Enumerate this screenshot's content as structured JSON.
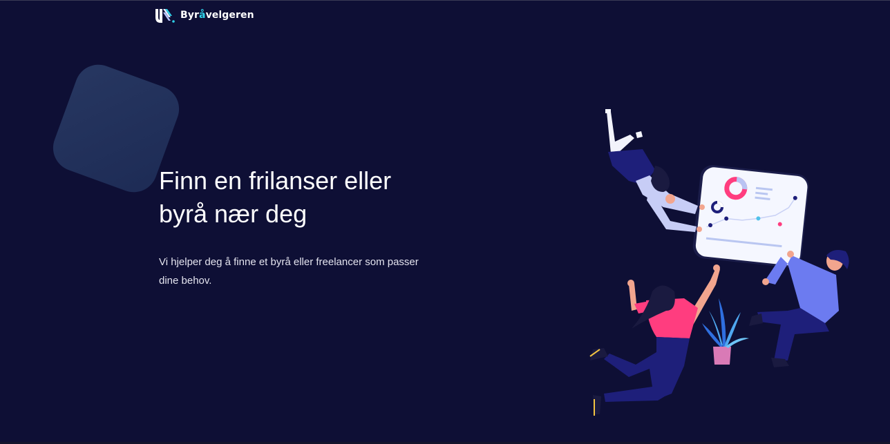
{
  "brand": {
    "name_prefix": "Byr",
    "name_accent": "å",
    "name_suffix": "velgeren",
    "accent_color": "#2ed1e8"
  },
  "hero": {
    "title_line1": "Finn en frilanser eller",
    "title_line2": "byrå nær deg",
    "subtitle_line1": "Vi hjelper deg å finne et byrå eller freelancer som passer",
    "subtitle_line2": "dine behov."
  },
  "theme": {
    "background": "#0e0f35",
    "decor_gradient": [
      "#26345f",
      "#1c2a52"
    ],
    "illustration_colors": [
      "#ff3d7f",
      "#6c7bf0",
      "#1e1f7a",
      "#4fd0e9",
      "#f5f7ff"
    ]
  },
  "icons": {
    "logo": "agency-logo-icon",
    "illustration": "people-with-analytics-dashboard-illustration"
  }
}
